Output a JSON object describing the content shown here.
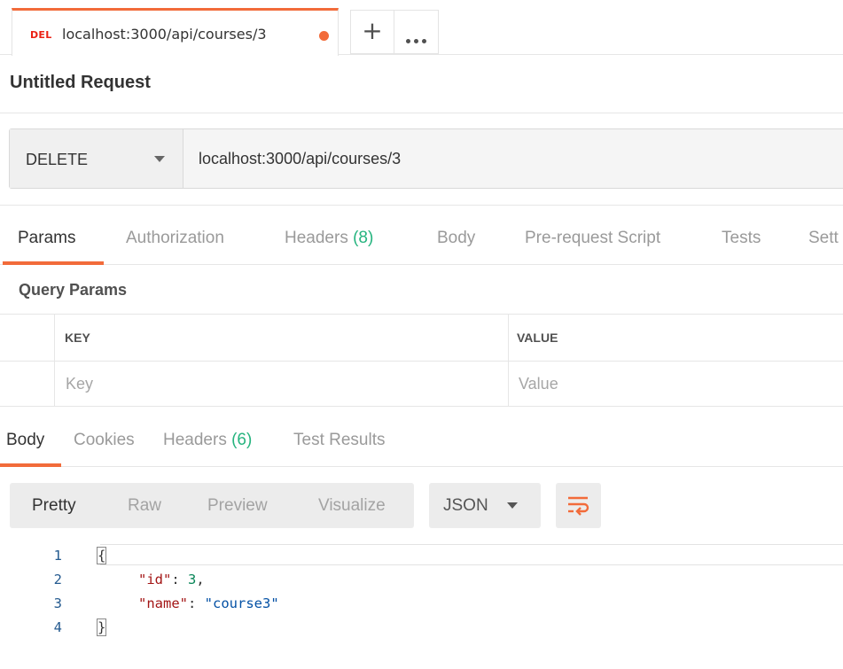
{
  "tab": {
    "method_badge": "DEL",
    "title": "localhost:3000/api/courses/3",
    "new_tab": "+",
    "colors": {
      "accent": "#f26b3a",
      "delete": "#eb2013",
      "count": "#26b47f"
    }
  },
  "request": {
    "name": "Untitled Request",
    "method": "DELETE",
    "url": "localhost:3000/api/courses/3"
  },
  "request_tabs": [
    {
      "label": "Params",
      "count": ""
    },
    {
      "label": "Authorization",
      "count": ""
    },
    {
      "label": "Headers",
      "count": "(8)"
    },
    {
      "label": "Body",
      "count": ""
    },
    {
      "label": "Pre-request Script",
      "count": ""
    },
    {
      "label": "Tests",
      "count": ""
    },
    {
      "label": "Sett",
      "count": ""
    }
  ],
  "query_params": {
    "title": "Query Params",
    "columns": [
      "KEY",
      "VALUE"
    ],
    "key_placeholder": "Key",
    "value_placeholder": "Value"
  },
  "response_tabs": [
    {
      "label": "Body",
      "count": ""
    },
    {
      "label": "Cookies",
      "count": ""
    },
    {
      "label": "Headers",
      "count": "(6)"
    },
    {
      "label": "Test Results",
      "count": ""
    }
  ],
  "view_modes": [
    "Pretty",
    "Raw",
    "Preview",
    "Visualize"
  ],
  "format": "JSON",
  "code": {
    "line_numbers": [
      "1",
      "2",
      "3",
      "4"
    ],
    "open_brace": "{",
    "close_brace": "}",
    "id_key": "\"id\"",
    "id_value": "3",
    "name_key": "\"name\"",
    "name_value": "\"course3\"",
    "colon": ": ",
    "comma": ","
  }
}
